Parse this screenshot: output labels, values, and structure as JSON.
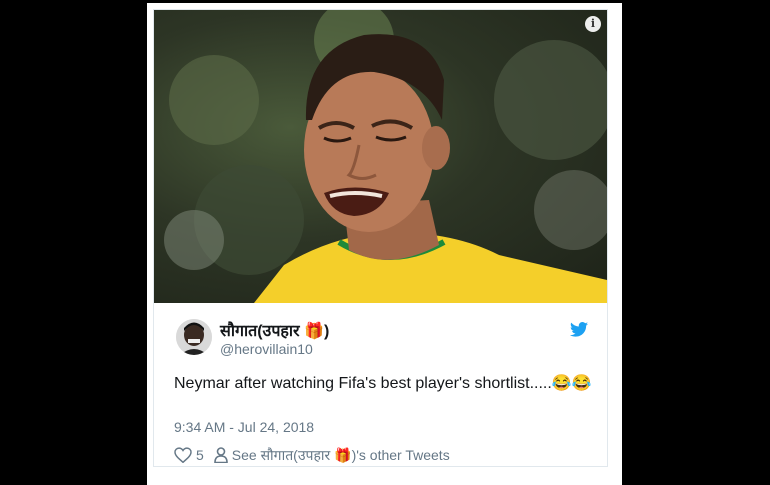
{
  "tweet": {
    "author_name": "सौगात(उपहार 🎁)",
    "author_handle": "@herovillain10",
    "text": "Neymar after watching Fifa's best player's shortlist.....😂😂",
    "timestamp": "9:34 AM - Jul 24, 2018",
    "like_count": "5",
    "see_other_label": "See सौगात(उपहार 🎁)'s other Tweets"
  },
  "icons": {
    "info": "info-icon",
    "twitter": "twitter-bird-icon",
    "like": "heart-icon",
    "person": "person-icon"
  },
  "colors": {
    "twitter_blue": "#1da1f2",
    "text": "#14171a",
    "secondary": "#657786",
    "jersey_yellow": "#f4cf2a",
    "jersey_green": "#1e8a3a"
  }
}
